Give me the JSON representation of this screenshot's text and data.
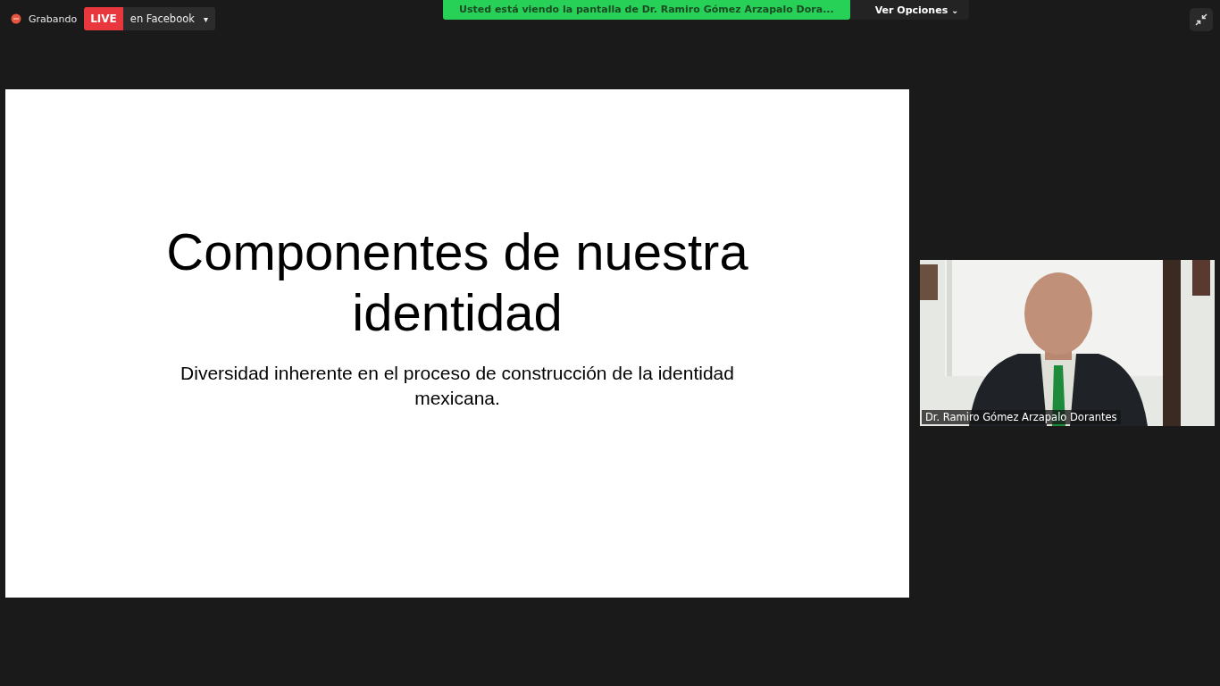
{
  "recording": {
    "label": "Grabando"
  },
  "live": {
    "badge": "LIVE",
    "target": "en Facebook",
    "caret": "▾"
  },
  "share_banner": {
    "text": "Usted está viendo la pantalla de Dr. Ramiro Gómez Arzapalo Dora...",
    "options": "Ver Opciones",
    "caret": "⌄"
  },
  "slide": {
    "title": "Componentes de nuestra identidad",
    "subtitle": "Diversidad inherente en el proceso de construcción de la identidad mexicana."
  },
  "video": {
    "kind": "picture",
    "name": "Dr. Ramiro Gómez Arzapalo Dorantes"
  }
}
